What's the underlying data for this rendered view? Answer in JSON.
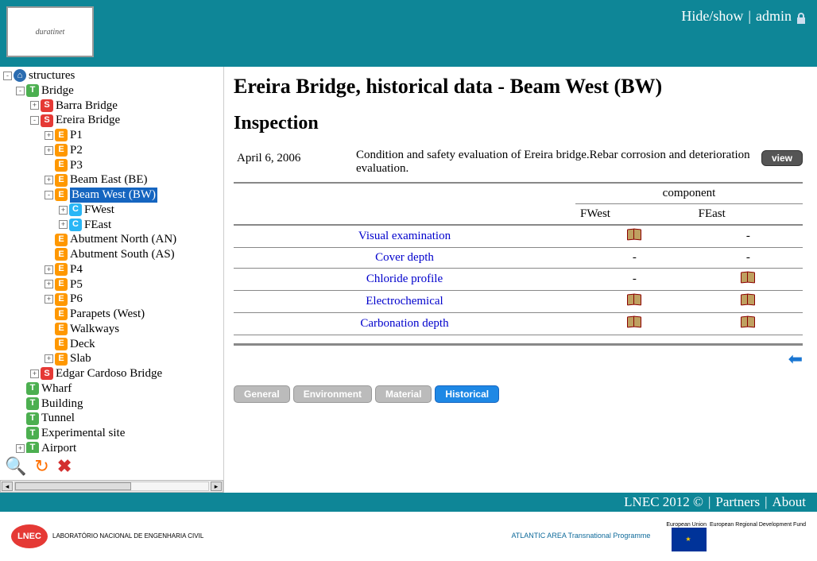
{
  "header": {
    "logo_text": "duratinet",
    "hide_show": "Hide/show",
    "admin": "admin"
  },
  "tree": [
    {
      "ind": 0,
      "tgl": "-",
      "badge": "home",
      "label": "structures"
    },
    {
      "ind": 1,
      "tgl": "-",
      "badge": "T",
      "label": "Bridge"
    },
    {
      "ind": 2,
      "tgl": "+",
      "badge": "S",
      "label": "Barra Bridge"
    },
    {
      "ind": 2,
      "tgl": "-",
      "badge": "S",
      "label": "Ereira Bridge"
    },
    {
      "ind": 3,
      "tgl": "+",
      "badge": "E",
      "label": "P1"
    },
    {
      "ind": 3,
      "tgl": "+",
      "badge": "E",
      "label": "P2"
    },
    {
      "ind": 3,
      "tgl": "",
      "badge": "E",
      "label": "P3"
    },
    {
      "ind": 3,
      "tgl": "+",
      "badge": "E",
      "label": "Beam East (BE)"
    },
    {
      "ind": 3,
      "tgl": "-",
      "badge": "E",
      "label": "Beam West (BW)",
      "selected": true
    },
    {
      "ind": 4,
      "tgl": "+",
      "badge": "C",
      "label": "FWest"
    },
    {
      "ind": 4,
      "tgl": "+",
      "badge": "C",
      "label": "FEast"
    },
    {
      "ind": 3,
      "tgl": "",
      "badge": "E",
      "label": "Abutment North (AN)"
    },
    {
      "ind": 3,
      "tgl": "",
      "badge": "E",
      "label": "Abutment South (AS)"
    },
    {
      "ind": 3,
      "tgl": "+",
      "badge": "E",
      "label": "P4"
    },
    {
      "ind": 3,
      "tgl": "+",
      "badge": "E",
      "label": "P5"
    },
    {
      "ind": 3,
      "tgl": "+",
      "badge": "E",
      "label": "P6"
    },
    {
      "ind": 3,
      "tgl": "",
      "badge": "E",
      "label": "Parapets (West)"
    },
    {
      "ind": 3,
      "tgl": "",
      "badge": "E",
      "label": "Walkways"
    },
    {
      "ind": 3,
      "tgl": "",
      "badge": "E",
      "label": "Deck"
    },
    {
      "ind": 3,
      "tgl": "+",
      "badge": "E",
      "label": "Slab"
    },
    {
      "ind": 2,
      "tgl": "+",
      "badge": "S",
      "label": "Edgar Cardoso Bridge"
    },
    {
      "ind": 1,
      "tgl": "",
      "badge": "T",
      "label": "Wharf"
    },
    {
      "ind": 1,
      "tgl": "",
      "badge": "T",
      "label": "Building"
    },
    {
      "ind": 1,
      "tgl": "",
      "badge": "T",
      "label": "Tunnel"
    },
    {
      "ind": 1,
      "tgl": "",
      "badge": "T",
      "label": "Experimental site"
    },
    {
      "ind": 1,
      "tgl": "+",
      "badge": "T",
      "label": "Airport"
    }
  ],
  "content": {
    "title": "Ereira Bridge, historical data - Beam West (BW)",
    "section": "Inspection",
    "date": "April 6, 2006",
    "desc": "Condition and safety evaluation of Ereira bridge.Rebar corrosion and deterioration evaluation.",
    "view": "view",
    "component_label": "component",
    "cols": [
      "FWest",
      "FEast"
    ],
    "rows": [
      {
        "label": "Visual examination",
        "cells": [
          "book",
          "-"
        ]
      },
      {
        "label": "Cover depth",
        "cells": [
          "-",
          "-"
        ]
      },
      {
        "label": "Chloride profile",
        "cells": [
          "-",
          "book"
        ]
      },
      {
        "label": "Electrochemical",
        "cells": [
          "book",
          "book"
        ]
      },
      {
        "label": "Carbonation depth",
        "cells": [
          "book",
          "book"
        ]
      }
    ]
  },
  "tabs": [
    {
      "label": "General",
      "active": false
    },
    {
      "label": "Environment",
      "active": false
    },
    {
      "label": "Material",
      "active": false
    },
    {
      "label": "Historical",
      "active": true
    }
  ],
  "footer1": {
    "copy": "LNEC 2012 ©",
    "partners": "Partners",
    "about": "About"
  },
  "footer2": {
    "lnec_abbr": "LNEC",
    "lnec_txt": "LABORATÓRIO NACIONAL\nDE ENGENHARIA CIVIL",
    "atlantic": "ATLANTIC AREA\nTransnational Programme",
    "eu_title": "European Union",
    "eu_txt": "European Regional\nDevelopment Fund"
  }
}
